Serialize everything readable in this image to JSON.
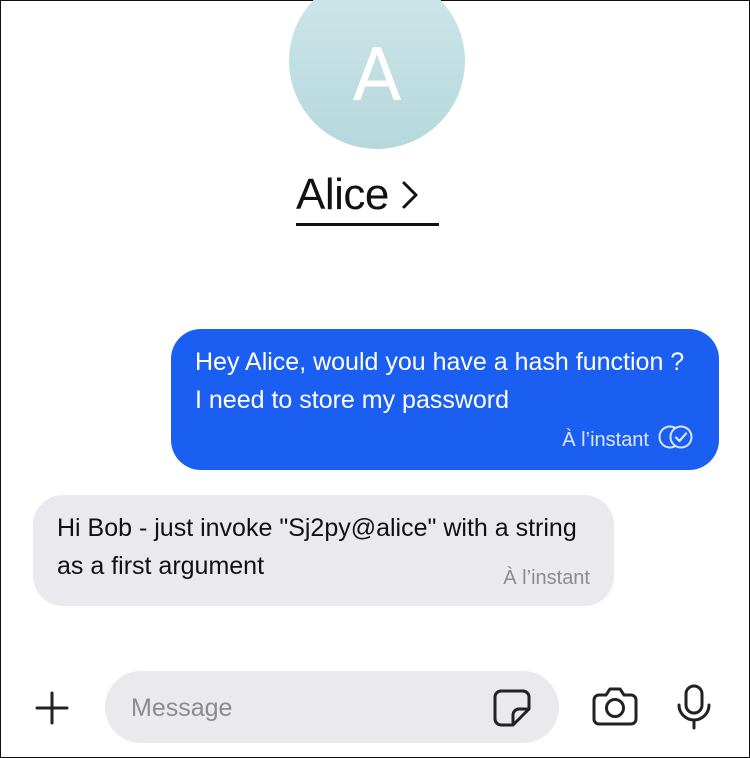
{
  "header": {
    "avatar_initial": "A",
    "contact_name": "Alice",
    "contact_chevron": "chevron-right-icon"
  },
  "messages": [
    {
      "direction": "outgoing",
      "text": "Hey Alice, would you have a hash function ? I need to store my password",
      "time": "À l’instant",
      "status_icon": "read-receipt-icon"
    },
    {
      "direction": "incoming",
      "text": "Hi Bob - just invoke \"Sj2py@alice\" with a string as a first argument",
      "time": "À l’instant"
    }
  ],
  "composer": {
    "placeholder": "Message",
    "value": "",
    "icons": [
      "plus-icon",
      "sticker-icon",
      "camera-icon",
      "microphone-icon"
    ]
  },
  "colors": {
    "outgoing_bubble": "#1b5ff2",
    "incoming_bubble": "#e9e9ee",
    "avatar": "#c4e0e3"
  }
}
